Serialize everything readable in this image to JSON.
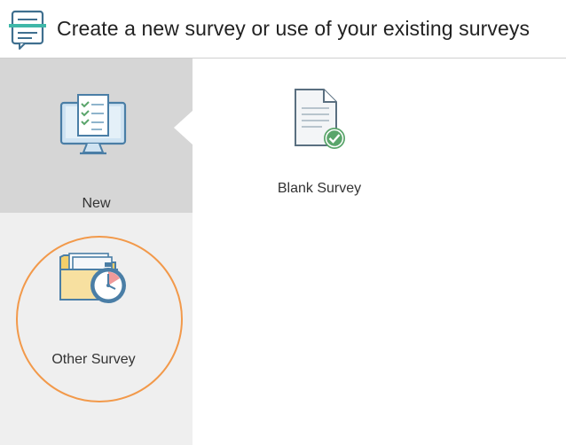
{
  "header": {
    "title": "Create a new survey or use of your existing surveys",
    "logo_icon": "survey-form-icon"
  },
  "sidebar": {
    "items": [
      {
        "label": "New",
        "icon": "monitor-checklist-icon",
        "active": true
      },
      {
        "label": "Other Survey",
        "icon": "folder-timer-icon",
        "active": false,
        "highlighted": true
      }
    ]
  },
  "main": {
    "tiles": [
      {
        "label": "Blank Survey",
        "icon": "document-check-icon"
      }
    ]
  },
  "colors": {
    "icon_blue": "#4a7ea6",
    "icon_light_blue": "#cfe3f2",
    "check_green": "#5aa56b",
    "folder_yellow": "#f5d985",
    "highlight_orange": "#f2994a",
    "active_bg": "#d6d6d6",
    "sidebar_bg": "#efefef"
  }
}
